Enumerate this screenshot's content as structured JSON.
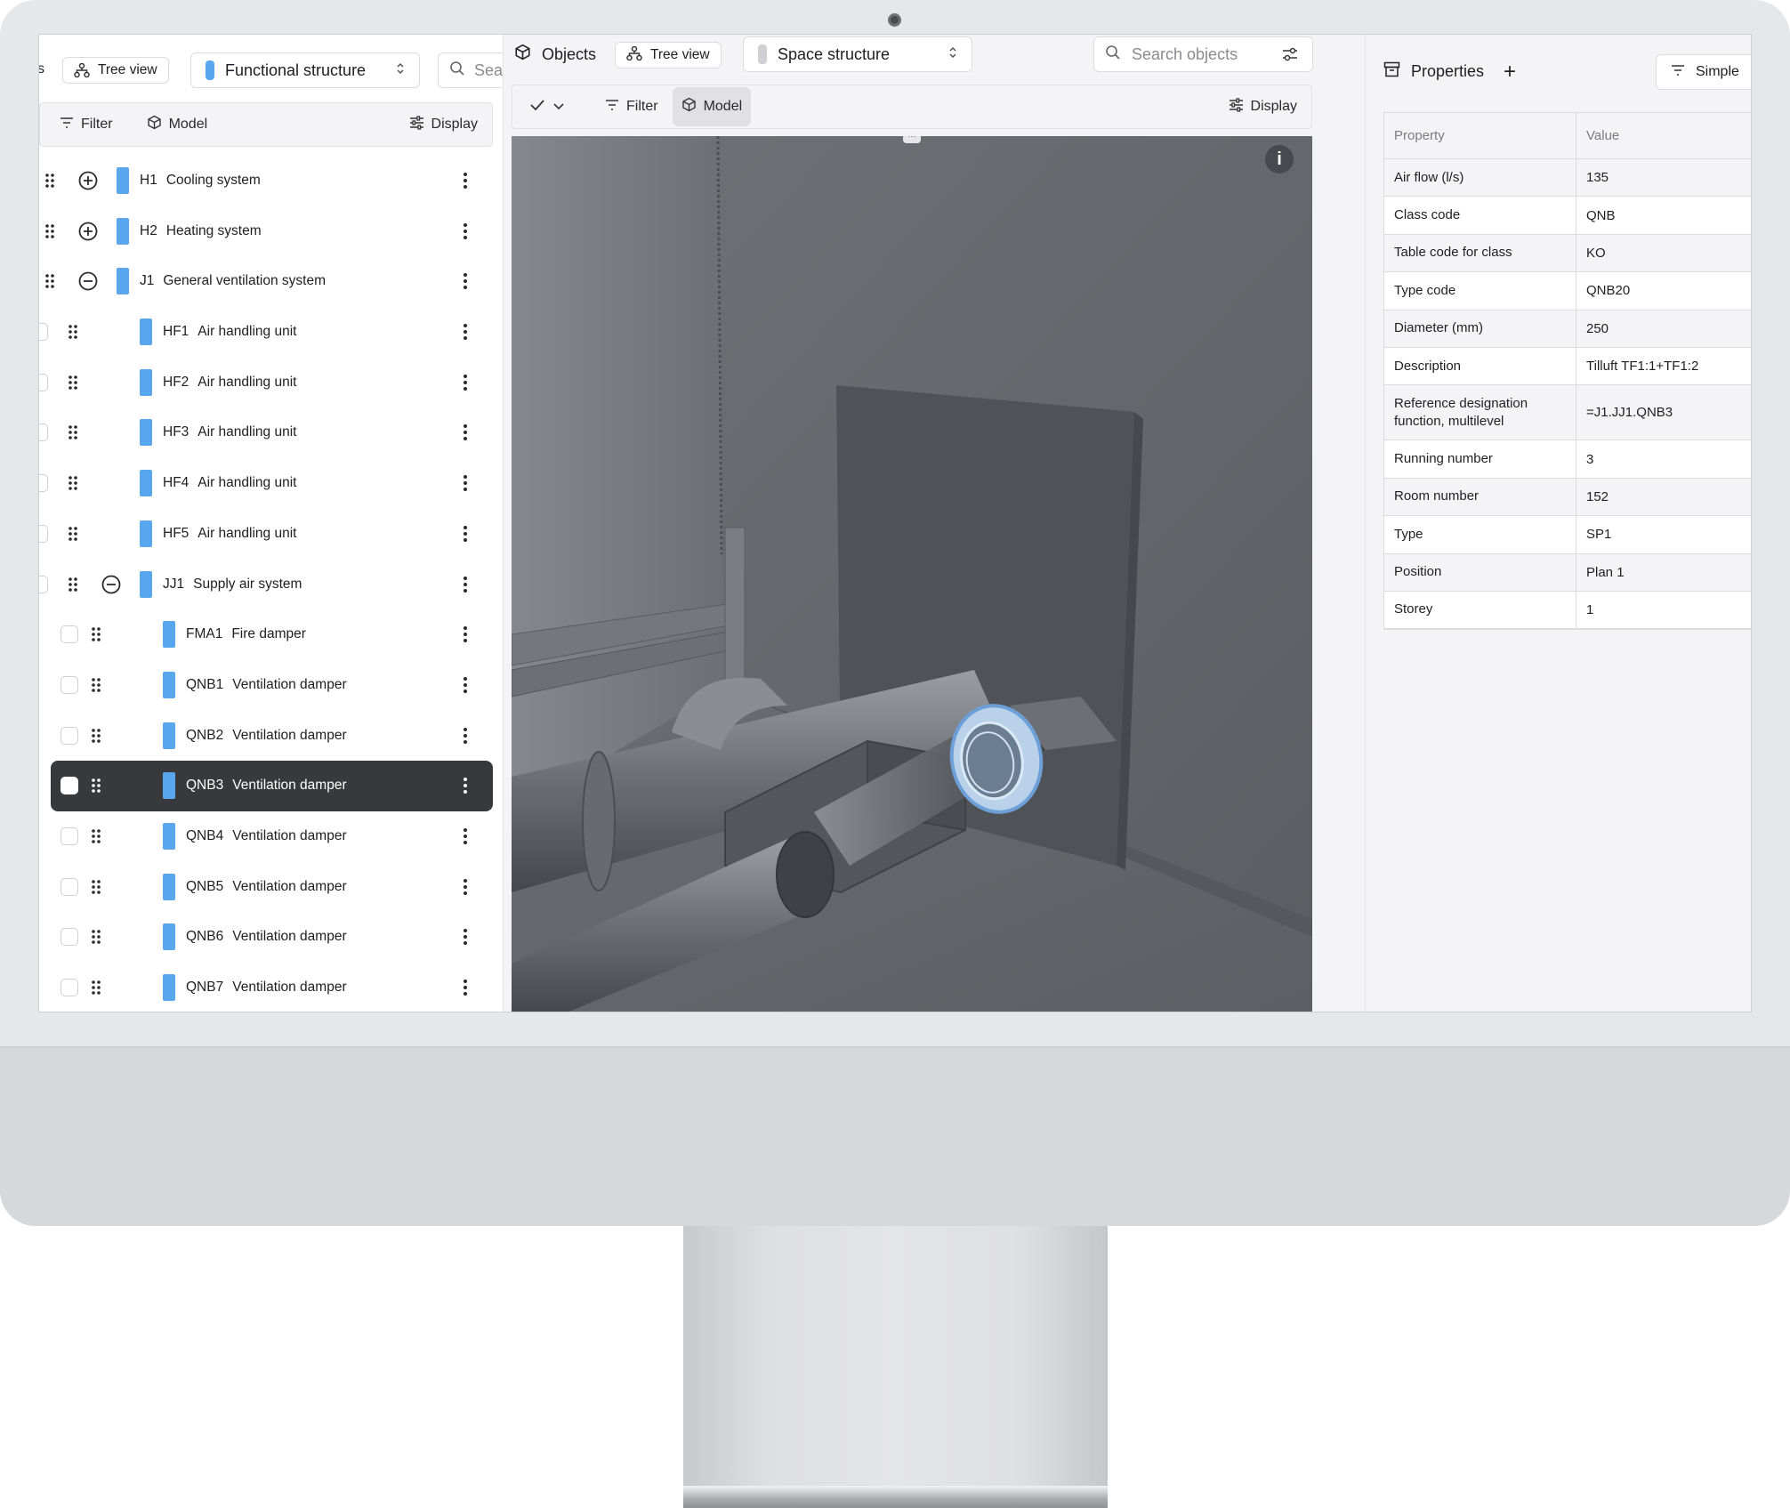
{
  "left_panel": {
    "cut_label": "s",
    "tree_view_label": "Tree view",
    "structure_select": "Functional structure",
    "search_partial": "Sea",
    "toolbar": {
      "filter": "Filter",
      "model": "Model",
      "display": "Display"
    },
    "items": [
      {
        "code": "H1",
        "name": "Cooling system"
      },
      {
        "code": "H2",
        "name": "Heating system"
      },
      {
        "code": "J1",
        "name": "General ventilation system"
      },
      {
        "code": "HF1",
        "name": "Air handling unit"
      },
      {
        "code": "HF2",
        "name": "Air handling unit"
      },
      {
        "code": "HF3",
        "name": "Air handling unit"
      },
      {
        "code": "HF4",
        "name": "Air handling unit"
      },
      {
        "code": "HF5",
        "name": "Air handling unit"
      },
      {
        "code": "JJ1",
        "name": "Supply air system"
      },
      {
        "code": "FMA1",
        "name": "Fire damper"
      },
      {
        "code": "QNB1",
        "name": "Ventilation damper"
      },
      {
        "code": "QNB2",
        "name": "Ventilation damper"
      },
      {
        "code": "QNB3",
        "name": "Ventilation damper"
      },
      {
        "code": "QNB4",
        "name": "Ventilation damper"
      },
      {
        "code": "QNB5",
        "name": "Ventilation damper"
      },
      {
        "code": "QNB6",
        "name": "Ventilation damper"
      },
      {
        "code": "QNB7",
        "name": "Ventilation damper"
      }
    ],
    "selected_item": "QNB3"
  },
  "center_panel": {
    "objects_label": "Objects",
    "tree_view_label": "Tree view",
    "structure_select": "Space structure",
    "search_placeholder": "Search objects",
    "toolbar": {
      "filter": "Filter",
      "model": "Model",
      "display": "Display"
    },
    "info_glyph": "i",
    "handle_glyph": "···"
  },
  "right_panel": {
    "title": "Properties",
    "add_glyph": "+",
    "mode_label": "Simple",
    "table_headers": {
      "property": "Property",
      "value": "Value"
    },
    "rows": [
      {
        "property": "Air flow (l/s)",
        "value": "135"
      },
      {
        "property": "Class code",
        "value": "QNB"
      },
      {
        "property": "Table code for class",
        "value": "KO"
      },
      {
        "property": "Type code",
        "value": "QNB20"
      },
      {
        "property": "Diameter (mm)",
        "value": "250"
      },
      {
        "property": "Description",
        "value": "Tilluft TF1:1+TF1:2"
      },
      {
        "property": "Reference designation function, multilevel",
        "value": "=J1.JJ1.QNB3"
      },
      {
        "property": "Running number",
        "value": "3"
      },
      {
        "property": "Room number",
        "value": "152"
      },
      {
        "property": "Type",
        "value": "SP1"
      },
      {
        "property": "Position",
        "value": "Plan 1"
      },
      {
        "property": "Storey",
        "value": "1"
      }
    ]
  },
  "colors": {
    "accent_blue": "#58a7ee",
    "selected_row": "#37393d",
    "panel_bg": "#f4f4f6",
    "viewport_bg": "#5f6266"
  }
}
